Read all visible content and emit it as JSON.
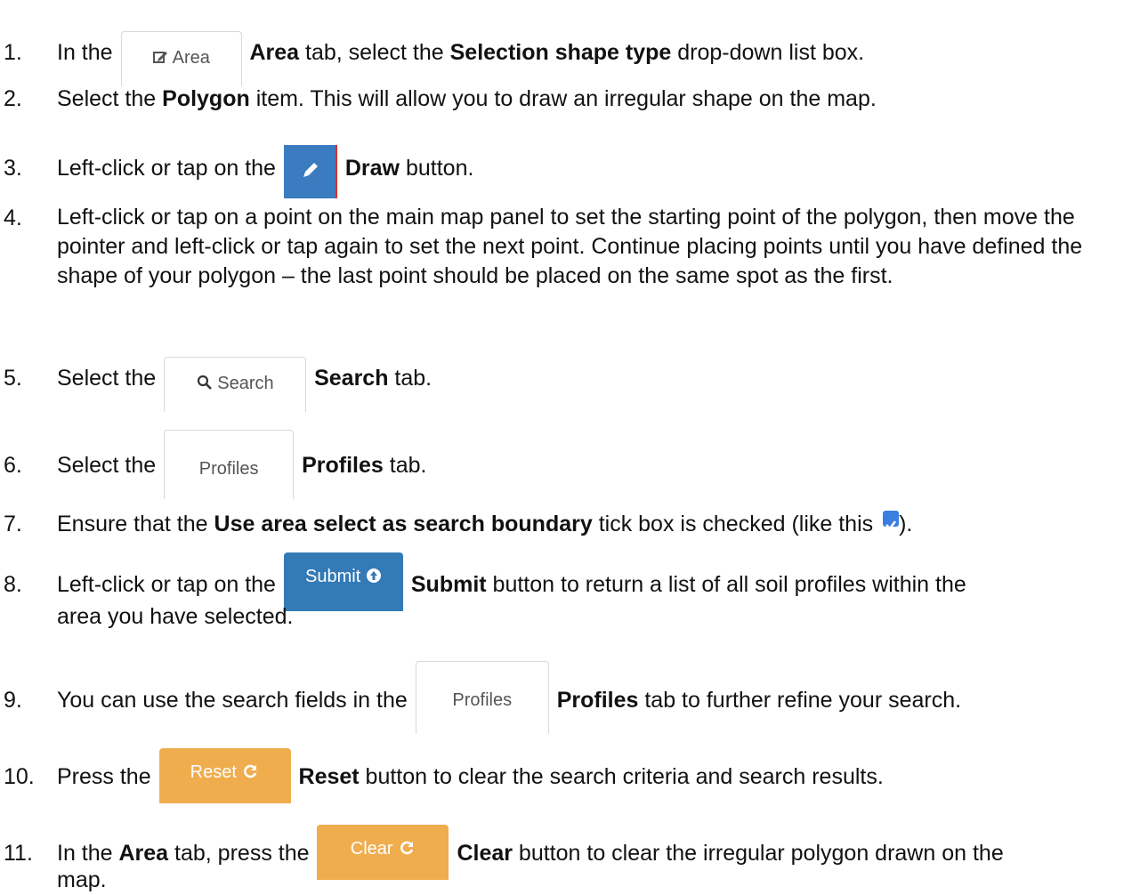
{
  "steps": [
    {
      "num": "1.",
      "pre": "In the",
      "button_label": "Area",
      "bold": "Area",
      "mid": " tab, select the ",
      "bold2": "Selection shape type",
      "post": " drop-down list box."
    },
    {
      "num": "2.",
      "pre": "Select the ",
      "bold": "Polygon",
      "post": " item. This will allow you to draw an irregular shape on the map."
    },
    {
      "num": "3.",
      "pre": "Left-click or tap on the",
      "bold": "Draw",
      "post": " button."
    },
    {
      "num": "4.",
      "text": "Left-click or tap on a point on the main map panel to set the starting point of the polygon, then move the pointer and left-click or tap again to set the next point. Continue placing points until you have defined the shape of your polygon – the last point should be placed on the same spot as the first."
    },
    {
      "num": "5.",
      "pre": "Select the",
      "button_label": "Search",
      "bold": "Search",
      "post": " tab."
    },
    {
      "num": "6.",
      "pre": "Select the",
      "button_label": "Profiles",
      "bold": "Profiles",
      "post": " tab."
    },
    {
      "num": "7.",
      "pre": "Ensure that the ",
      "bold": "Use area select as search boundary",
      "post": " tick box is checked (like this ",
      "post2": ")."
    },
    {
      "num": "8.",
      "pre": "Left-click or tap on the",
      "button_label": "Submit",
      "bold": "Submit",
      "post": " button to return a list of all soil profiles within the",
      "line2": "area you have selected."
    },
    {
      "num": "9.",
      "pre": "You can use the search fields in the",
      "button_label": "Profiles",
      "bold": "Profiles",
      "post": " tab to further refine your search."
    },
    {
      "num": "10.",
      "pre": "Press the",
      "button_label": "Reset",
      "bold": "Reset",
      "post": " button to clear the search criteria and search results."
    },
    {
      "num": "11.",
      "pre": "In the ",
      "bold_a": "Area",
      "mid": " tab, press the",
      "button_label": "Clear",
      "bold": "Clear",
      "post": " button to clear the irregular polygon drawn on the",
      "line2": "map."
    }
  ],
  "icons": {
    "area": "edit-icon",
    "draw": "pencil-icon",
    "search": "search-icon",
    "submit": "arrow-up-circle-icon",
    "reset": "refresh-icon",
    "clear": "refresh-icon",
    "checkbox": "checked-checkbox-icon"
  },
  "colors": {
    "primary": "#337ab7",
    "warning": "#f0ad4e",
    "checkbox": "#3a7ee0"
  }
}
